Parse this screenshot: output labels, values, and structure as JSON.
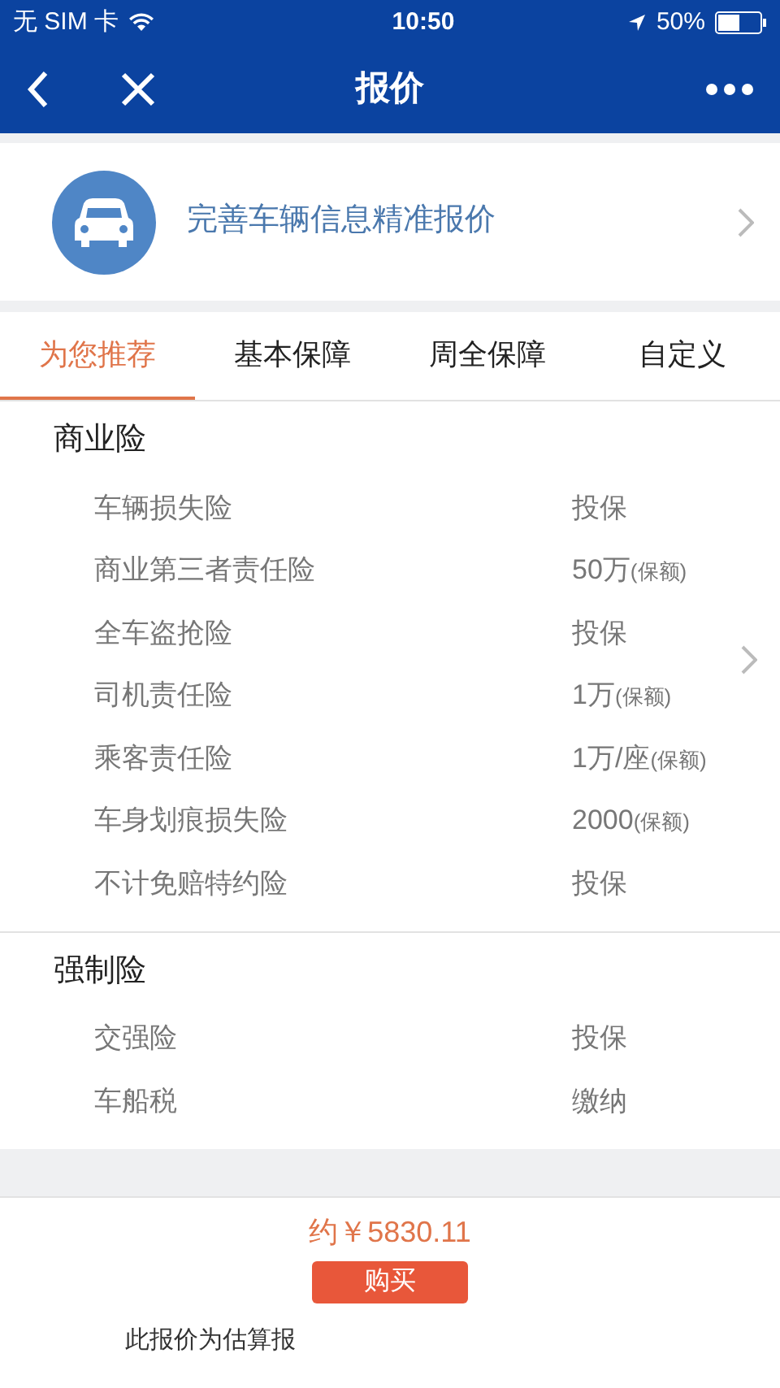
{
  "status_bar": {
    "carrier": "无 SIM 卡",
    "time": "10:50",
    "battery": "50%"
  },
  "nav": {
    "title": "报价"
  },
  "banner": {
    "text": "完善车辆信息精准报价"
  },
  "tabs": [
    {
      "label": "为您推荐",
      "selected": true
    },
    {
      "label": "基本保障",
      "selected": false
    },
    {
      "label": "周全保障",
      "selected": false
    },
    {
      "label": "自定义",
      "selected": false
    }
  ],
  "sections": [
    {
      "title": "商业险",
      "expandable": true,
      "rows": [
        {
          "name": "车辆损失险",
          "value": "投保"
        },
        {
          "name": "商业第三者责任险",
          "value": "50万",
          "note": "(保额)"
        },
        {
          "name": "全车盗抢险",
          "value": "投保"
        },
        {
          "name": "司机责任险",
          "value": "1万",
          "note": "(保额)"
        },
        {
          "name": "乘客责任险",
          "value": "1万/座",
          "note": "(保额)"
        },
        {
          "name": "车身划痕损失险",
          "value": "2000",
          "note": "(保额)"
        },
        {
          "name": "不计免赔特约险",
          "value": "投保"
        }
      ]
    },
    {
      "title": "强制险",
      "expandable": false,
      "rows": [
        {
          "name": "交强险",
          "value": "投保"
        },
        {
          "name": "车船税",
          "value": "缴纳"
        }
      ]
    }
  ],
  "footer": {
    "price": "约￥5830.11",
    "button": "购买",
    "disclaimer": "此报价为估算报"
  }
}
